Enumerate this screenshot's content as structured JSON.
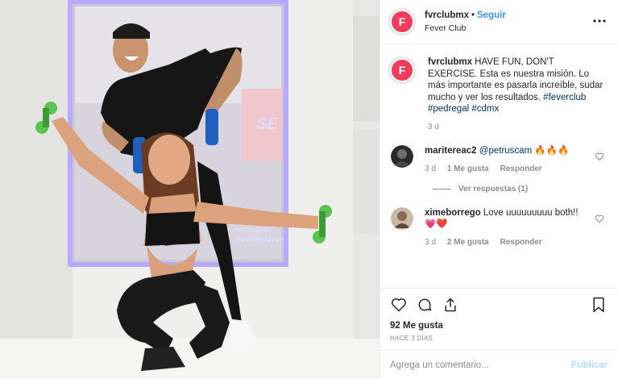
{
  "post": {
    "username": "fvrclubmx",
    "avatar_letter": "F",
    "separator": "•",
    "follow_label": "Seguir",
    "location": "Fever Club",
    "more_icon": "more-horizontal-icon"
  },
  "photo": {
    "mirror_text_1": "fvrclubmx",
    "mirror_text_2": "#feelthefever",
    "wall_text": "SE"
  },
  "caption": {
    "username": "fvrclubmx",
    "text": " HAVE FUN, DON'T EXERCISE. Esta es nuestra misión. Lo más importante es pasarla increíble, sudar mucho y ver los resultados. ",
    "tags": [
      "#feverclub",
      "#pedregal",
      "#cdmx"
    ],
    "age": "3 d"
  },
  "comments": [
    {
      "username": "maritereac2",
      "mention": "@petruscam",
      "text": " 🔥🔥🔥",
      "age": "3 d",
      "likes": "1 Me gusta",
      "reply_label": "Responder",
      "view_replies": "Ver respuestas (1)"
    },
    {
      "username": "ximeborrego",
      "text": " Love uuuuuuuuu both!!💗❤️",
      "age": "3 d",
      "likes": "2 Me gusta",
      "reply_label": "Responder"
    }
  ],
  "actions": {
    "likes_count": "92 Me gusta",
    "time_ago": "HACE 3 DÍAS",
    "icons": [
      "heart-icon",
      "comment-icon",
      "share-icon",
      "bookmark-icon"
    ]
  },
  "composer": {
    "placeholder": "Agrega un comentario...",
    "publish_label": "Publicar"
  },
  "colors": {
    "link": "#3897f0",
    "hashtag": "#003569",
    "brand": "#f03c5b",
    "muted": "#8e8e8e"
  }
}
